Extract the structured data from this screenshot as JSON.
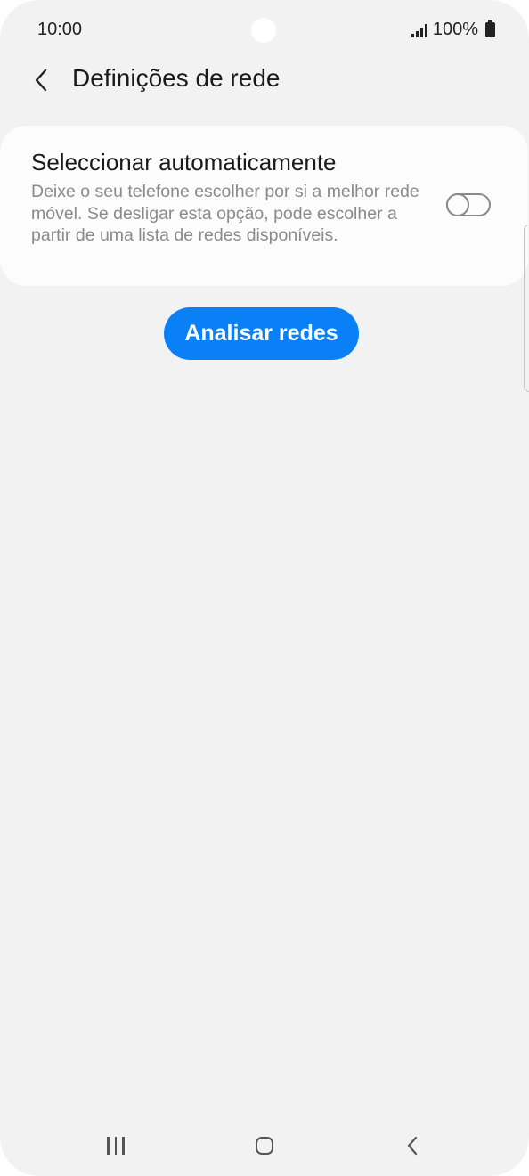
{
  "status_bar": {
    "time": "10:00",
    "battery": "100%",
    "icons": [
      "camera-cutout",
      "signal-icon",
      "battery-icon"
    ]
  },
  "header": {
    "back_icon": "chevron-left-icon",
    "title": "Definições de rede"
  },
  "auto_select": {
    "title": "Seleccionar automaticamente",
    "description": "Deixe o seu telefone escolher por si a melhor rede móvel. Se desligar esta opção, pode escolher a partir de uma lista de redes disponíveis.",
    "toggle_on": false
  },
  "scan_button": {
    "label": "Analisar redes",
    "color": "#0a80f7"
  },
  "nav_bar": {
    "icons": [
      "recents-icon",
      "home-icon",
      "back-icon"
    ]
  }
}
